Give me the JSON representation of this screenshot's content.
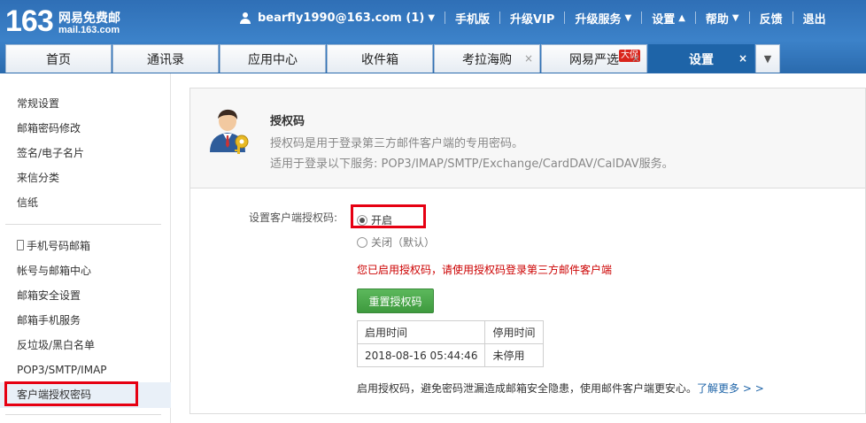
{
  "header": {
    "logo_number": "163",
    "logo_title": "网易免费邮",
    "logo_domain": "mail.163.com",
    "nav": {
      "user": "bearfly1990@163.com (1)",
      "mobile": "手机版",
      "vip": "升级VIP",
      "upgrade_service": "升级服务",
      "settings": "设置",
      "help": "帮助",
      "feedback": "反馈",
      "logout": "退出"
    }
  },
  "tabs": [
    {
      "label": "首页"
    },
    {
      "label": "通讯录"
    },
    {
      "label": "应用中心"
    },
    {
      "label": "收件箱"
    },
    {
      "label": "考拉海购"
    },
    {
      "label": "网易严选",
      "badge": "大促"
    },
    {
      "label": "设置"
    }
  ],
  "close_glyph": "×",
  "sidebar": {
    "group1": [
      "常规设置",
      "邮箱密码修改",
      "签名/电子名片",
      "来信分类",
      "信纸"
    ],
    "group2": [
      "手机号码邮箱",
      "帐号与邮箱中心",
      "邮箱安全设置",
      "邮箱手机服务",
      "反垃圾/黑白名单",
      "POP3/SMTP/IMAP",
      "客户端授权密码"
    ]
  },
  "main": {
    "title": "授权码",
    "desc1": "授权码是用于登录第三方邮件客户端的专用密码。",
    "desc2": "适用于登录以下服务: POP3/IMAP/SMTP/Exchange/CardDAV/CalDAV服务。",
    "setting_label": "设置客户端授权码:",
    "option_on": "开启",
    "option_off": "关闭（默认）",
    "option_selected": "开启",
    "warning": "您已启用授权码，请使用授权码登录第三方邮件客户端",
    "reset_button": "重置授权码",
    "table": {
      "headers": [
        "启用时间",
        "停用时间"
      ],
      "rows": [
        [
          "2018-08-16 05:44:46",
          "未停用"
        ]
      ]
    },
    "footer_text": "启用授权码，避免密码泄漏造成邮箱安全隐患，使用邮件客户端更安心。",
    "learn_more": "了解更多 > >"
  },
  "colors": {
    "header_blue": "#2f6fb6",
    "active_tab": "#1e64a8",
    "highlight_red": "#e60012",
    "button_green": "#4cae4c",
    "warning_red": "#cc0000"
  },
  "icons": [
    "user-icon",
    "chevron-down-icon",
    "chevron-up-icon",
    "close-icon",
    "phone-icon",
    "user-key-icon"
  ]
}
